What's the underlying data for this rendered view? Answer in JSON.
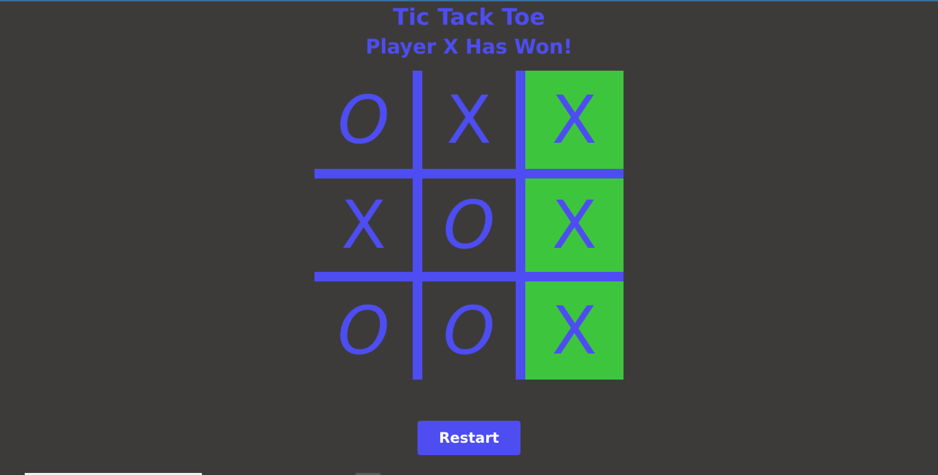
{
  "game": {
    "title": "Tic Tack Toe",
    "status": "Player X Has Won!"
  },
  "board": {
    "cells": [
      {
        "mark": "O",
        "winning": false
      },
      {
        "mark": "X",
        "winning": false
      },
      {
        "mark": "X",
        "winning": true
      },
      {
        "mark": "X",
        "winning": false
      },
      {
        "mark": "O",
        "winning": false
      },
      {
        "mark": "X",
        "winning": true
      },
      {
        "mark": "O",
        "winning": false
      },
      {
        "mark": "O",
        "winning": false
      },
      {
        "mark": "X",
        "winning": true
      }
    ]
  },
  "controls": {
    "restart_label": "Restart"
  },
  "colors": {
    "background": "#3d3b3a",
    "accent": "#4d4df2",
    "win_highlight": "#3dc63d"
  }
}
